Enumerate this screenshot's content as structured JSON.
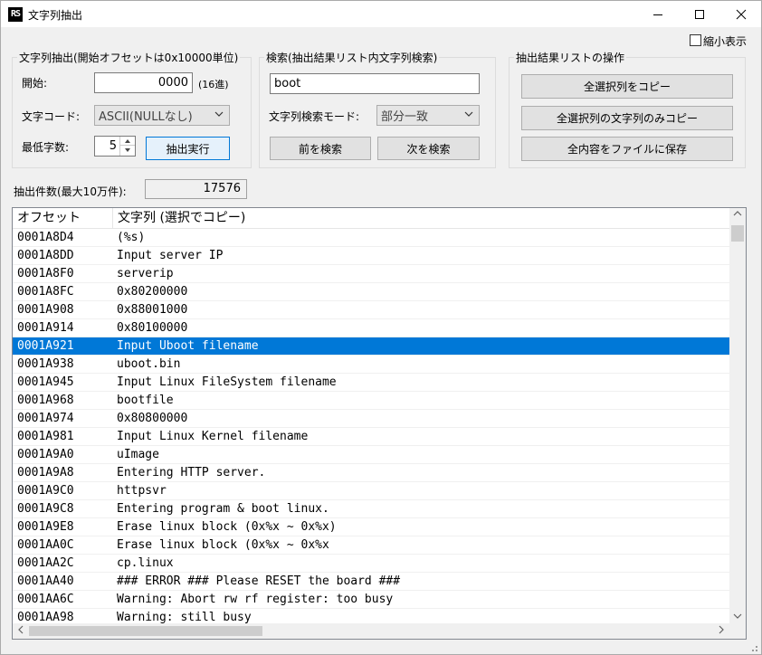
{
  "window": {
    "title": "文字列抽出",
    "icon_text": "RS",
    "minimize_icon": "minimize-icon",
    "maximize_icon": "maximize-icon",
    "close_icon": "close-icon"
  },
  "compact_label": "縮小表示",
  "extract": {
    "legend": "文字列抽出(開始オフセットは0x10000単位)",
    "start_label": "開始:",
    "start_value": "0000",
    "start_unit": "(16進)",
    "encoding_label": "文字コード:",
    "encoding_value": "ASCII(NULLなし)",
    "minlen_label": "最低字数:",
    "minlen_value": "5",
    "run_label": "抽出実行"
  },
  "search": {
    "legend": "検索(抽出結果リスト内文字列検索)",
    "query": "boot",
    "mode_label": "文字列検索モード:",
    "mode_value": "部分一致",
    "prev_label": "前を検索",
    "next_label": "次を検索"
  },
  "ops": {
    "legend": "抽出結果リストの操作",
    "copy_all_label": "全選択列をコピー",
    "copy_strings_label": "全選択列の文字列のみコピー",
    "save_label": "全内容をファイルに保存"
  },
  "count": {
    "label": "抽出件数(最大10万件):",
    "value": "17576"
  },
  "table": {
    "col_offset": "オフセット",
    "col_string": "文字列 (選択でコピー)",
    "selected_index": 6,
    "rows": [
      [
        "0001A8D4",
        "(%s)"
      ],
      [
        "0001A8DD",
        "Input server IP"
      ],
      [
        "0001A8F0",
        "serverip"
      ],
      [
        "0001A8FC",
        "0x80200000"
      ],
      [
        "0001A908",
        "0x88001000"
      ],
      [
        "0001A914",
        "0x80100000"
      ],
      [
        "0001A921",
        "Input Uboot filename"
      ],
      [
        "0001A938",
        "uboot.bin"
      ],
      [
        "0001A945",
        "Input Linux FileSystem filename"
      ],
      [
        "0001A968",
        "bootfile"
      ],
      [
        "0001A974",
        "0x80800000"
      ],
      [
        "0001A981",
        "Input Linux Kernel filename"
      ],
      [
        "0001A9A0",
        "uImage"
      ],
      [
        "0001A9A8",
        "Entering HTTP server."
      ],
      [
        "0001A9C0",
        "httpsvr"
      ],
      [
        "0001A9C8",
        "Entering program & boot linux."
      ],
      [
        "0001A9E8",
        "Erase linux block (0x%x ~ 0x%x)"
      ],
      [
        "0001AA0C",
        "Erase linux block (0x%x ~ 0x%x"
      ],
      [
        "0001AA2C",
        "cp.linux"
      ],
      [
        "0001AA40",
        "### ERROR ### Please RESET the board ###"
      ],
      [
        "0001AA6C",
        "Warning: Abort rw rf register: too busy"
      ],
      [
        "0001AA98",
        "Warning: still busy"
      ]
    ]
  }
}
